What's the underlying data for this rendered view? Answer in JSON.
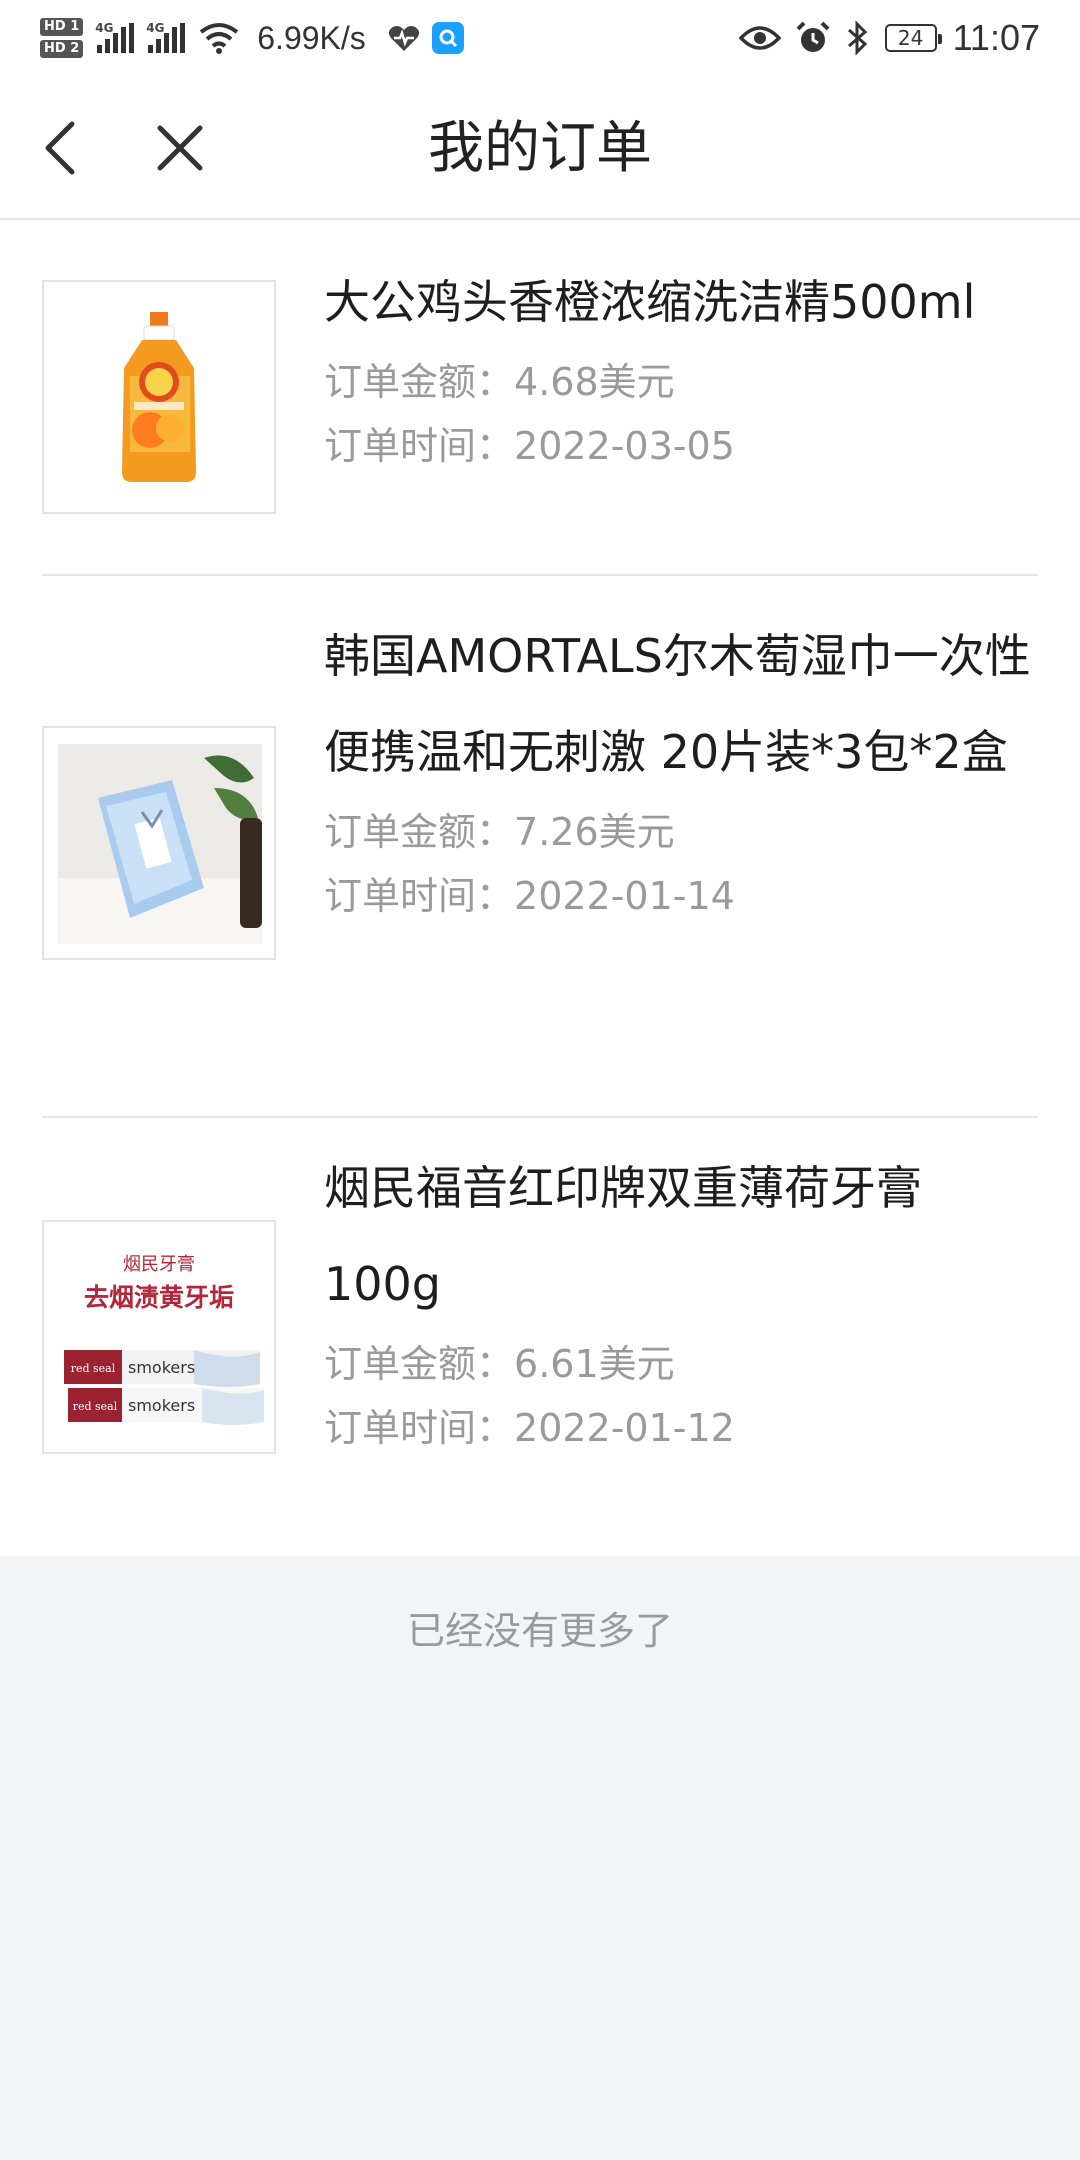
{
  "status_bar": {
    "hd1": "HD 1",
    "hd2": "HD 2",
    "net1": "4G",
    "net2": "4G",
    "speed": "6.99K/s",
    "battery": "24",
    "time": "11:07"
  },
  "nav": {
    "title": "我的订单"
  },
  "orders": [
    {
      "title": "大公鸡头香橙浓缩洗洁精500ml",
      "amount_label": "订单金额：",
      "amount": "4.68美元",
      "time_label": "订单时间：",
      "time": "2022-03-05"
    },
    {
      "title": "韩国AMORTALS尔木萄湿巾一次性便携温和无刺激 20片装*3包*2盒",
      "amount_label": "订单金额：",
      "amount": "7.26美元",
      "time_label": "订单时间：",
      "time": "2022-01-14"
    },
    {
      "title": "烟民福音红印牌双重薄荷牙膏100g",
      "amount_label": "订单金额：",
      "amount": "6.61美元",
      "time_label": "订单时间：",
      "time": "2022-01-12",
      "image_text": {
        "line1": "烟民牙膏",
        "line2": "去烟渍黄牙垢",
        "brand": "red seal",
        "product": "smokers"
      }
    }
  ],
  "footer": {
    "end_text": "已经没有更多了"
  },
  "colors": {
    "background": "#f3f4f6",
    "card": "#ffffff",
    "title_text": "#1e1e1e",
    "meta_text": "#9a9a9a",
    "divider": "#e6e6e6"
  }
}
